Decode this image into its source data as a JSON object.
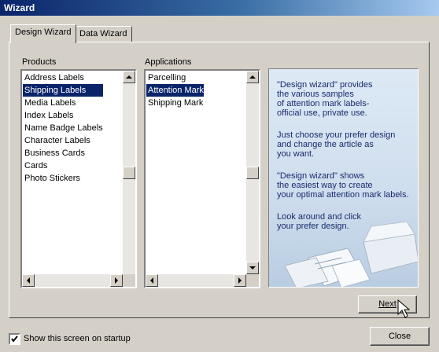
{
  "window": {
    "title": "Wizard"
  },
  "tabs": [
    {
      "label": "Design Wizard",
      "active": true
    },
    {
      "label": "Data Wizard",
      "active": false
    }
  ],
  "products": {
    "label": "Products",
    "items": [
      "Address Labels",
      "Shipping Labels",
      "Media Labels",
      "Index Labels",
      "Name Badge Labels",
      "Character Labels",
      "Business Cards",
      "Cards",
      "Photo Stickers"
    ],
    "selected": "Shipping Labels"
  },
  "applications": {
    "label": "Applications",
    "items": [
      "Parcelling",
      "Attention Mark",
      "Shipping Mark"
    ],
    "selected": "Attention Mark"
  },
  "info": {
    "paragraphs": [
      "\"Design wizard\" provides\nthe various samples\nof attention mark labels-\nofficial use, private use.",
      "Just choose your prefer design\nand change the article as\nyou want.",
      "\"Design wizard\" shows\nthe easiest way to create\nyour optimal attention mark labels.",
      "Look around and click\nyour prefer design."
    ],
    "text_color": "#1a2a6e"
  },
  "buttons": {
    "next": "Next",
    "close": "Close"
  },
  "startup": {
    "label": "Show this screen on startup",
    "checked": true
  },
  "colors": {
    "selection": "#0a246a",
    "face": "#d4d0c8"
  }
}
